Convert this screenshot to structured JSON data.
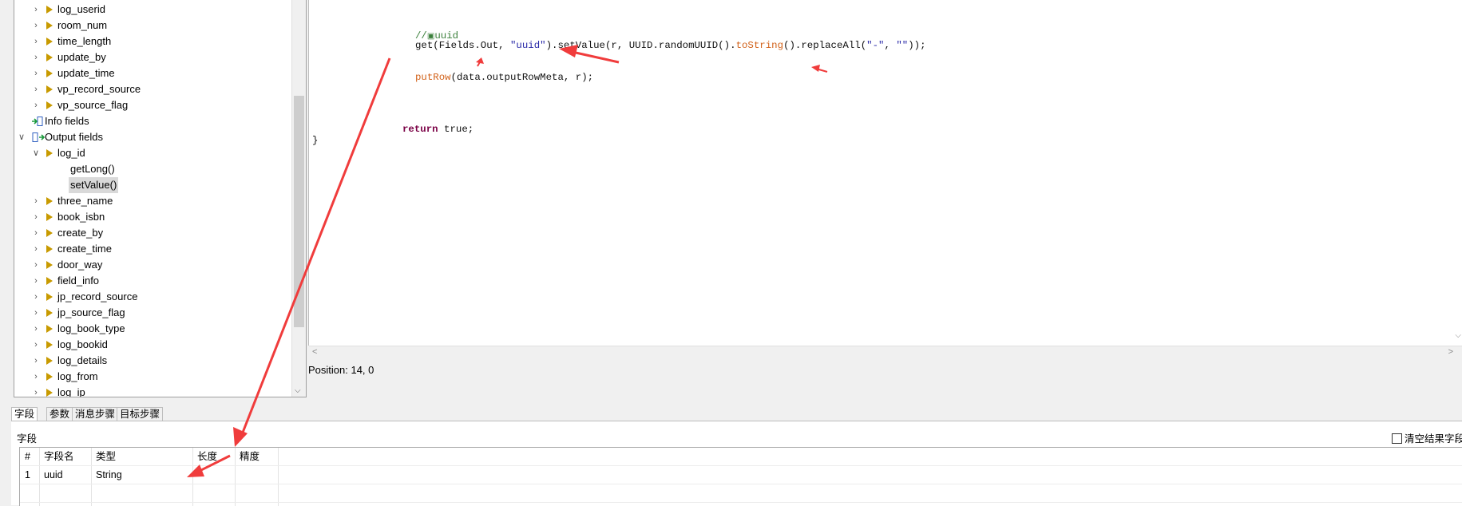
{
  "tree": {
    "input_items": [
      "log_userid",
      "room_num",
      "time_length",
      "update_by",
      "update_time",
      "vp_record_source",
      "vp_source_flag"
    ],
    "info_fields": "Info fields",
    "output_fields": "Output fields",
    "log_id": "log_id",
    "log_id_children": [
      "getLong()",
      "setValue()"
    ],
    "output_items": [
      "three_name",
      "book_isbn",
      "create_by",
      "create_time",
      "door_way",
      "field_info",
      "jp_record_source",
      "jp_source_flag",
      "log_book_type",
      "log_bookid",
      "log_details",
      "log_from",
      "log_ip"
    ]
  },
  "editor": {
    "comment_prefix": "//",
    "comment_text": "uuid",
    "line_get_1": "get(Fields.Out, ",
    "line_get_str": "\"uuid\"",
    "line_get_2": ").setValue(r, UUID.randomUUID().",
    "line_get_method": "toString",
    "line_get_3": "().replaceAll(",
    "line_get_str2": "\"-\"",
    "line_get_4": ", ",
    "line_get_str3": "\"\"",
    "line_get_5": "));",
    "line_put_method": "putRow",
    "line_put_rest": "(data.outputRowMeta, r);",
    "line_return_kw": "return",
    "line_return_rest": " true;",
    "closing_brace": "}",
    "position": "Position: 14, 0"
  },
  "tabs": [
    "字段",
    "参数",
    "消息步骤",
    "目标步骤"
  ],
  "fields_panel": {
    "title": "字段",
    "clear_checkbox_label": "清空结果字段",
    "columns": [
      "#",
      "字段名",
      "类型",
      "长度",
      "精度"
    ],
    "rows": [
      {
        "num": "1",
        "name": "uuid",
        "type": "String",
        "length": "",
        "precision": ""
      }
    ]
  },
  "colors": {
    "arrow": "#f03c3c",
    "tree_triangle": "#c89a00",
    "code_method": "#d2621a",
    "code_keyword": "#7a0045",
    "code_string": "#2a2aa8",
    "code_comment": "#3a7f3a"
  }
}
